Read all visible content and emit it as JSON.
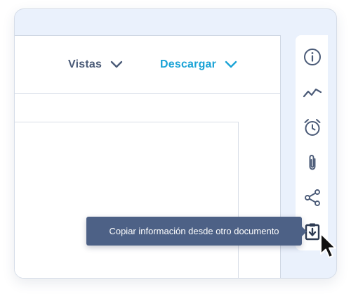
{
  "toolbar": {
    "views_label": "Vistas",
    "download_label": "Descargar"
  },
  "rail": {
    "icons": [
      "info-icon",
      "trend-icon",
      "alarm-clock-icon",
      "paperclip-icon",
      "share-icon",
      "import-clipboard-icon"
    ]
  },
  "tooltip": {
    "text": "Copiar información desde otro documento"
  },
  "colors": {
    "accent": "#1aa3d6",
    "icon": "#4a5a77",
    "tooltip_bg": "#4d6186",
    "card_bg": "#eaf1fc"
  }
}
